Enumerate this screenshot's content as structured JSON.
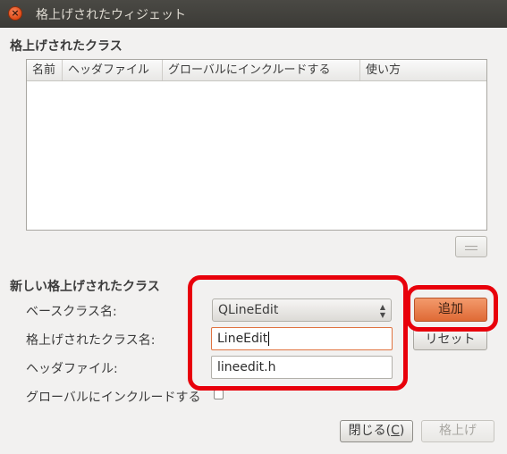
{
  "window": {
    "title": "格上げされたウィジェット",
    "close_glyph": "×"
  },
  "promoted_classes": {
    "heading": "格上げされたクラス",
    "columns": [
      "名前",
      "ヘッダファイル",
      "グローバルにインクルードする",
      "使い方"
    ],
    "rows": []
  },
  "new_class": {
    "heading": "新しい格上げされたクラス",
    "base_class_label": "ベースクラス名:",
    "base_class_value": "QLineEdit",
    "promoted_name_label": "格上げされたクラス名:",
    "promoted_name_value": "LineEdit",
    "header_file_label": "ヘッダファイル:",
    "header_file_value": "lineedit.h",
    "global_include_label": "グローバルにインクルードする",
    "global_include_checked": false
  },
  "buttons": {
    "add": "追加",
    "reset": "リセット",
    "close_prefix": "閉じる(",
    "close_mnemonic": "C",
    "close_suffix": ")",
    "promote": "格上げ"
  },
  "colors": {
    "accent": "#df6a35",
    "annotation": "#e8000b"
  }
}
